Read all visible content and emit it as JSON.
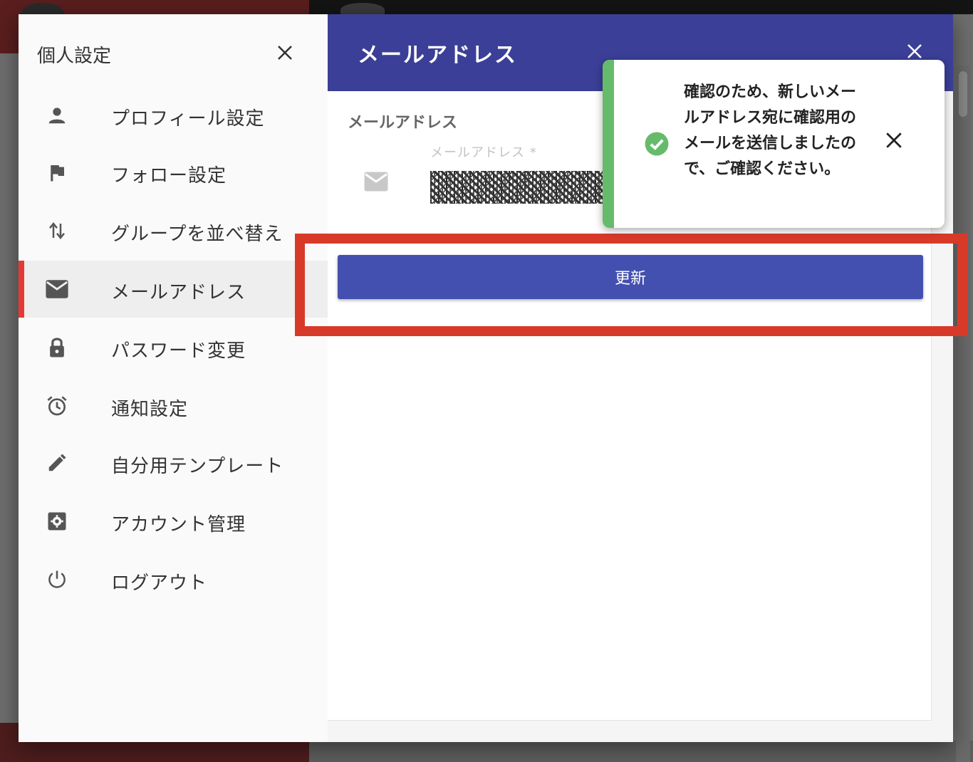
{
  "sidebar": {
    "title": "個人設定",
    "items": [
      {
        "label": "プロフィール設定",
        "icon": "person-icon"
      },
      {
        "label": "フォロー設定",
        "icon": "flag-icon"
      },
      {
        "label": "グループを並べ替え",
        "icon": "sort-arrows-icon"
      },
      {
        "label": "メールアドレス",
        "icon": "mail-icon",
        "active": true
      },
      {
        "label": "パスワード変更",
        "icon": "lock-icon"
      },
      {
        "label": "通知設定",
        "icon": "alarm-icon"
      },
      {
        "label": "自分用テンプレート",
        "icon": "pencil-icon"
      },
      {
        "label": "アカウント管理",
        "icon": "settings-box-icon"
      },
      {
        "label": "ログアウト",
        "icon": "power-icon"
      }
    ]
  },
  "main": {
    "title": "メールアドレス",
    "section_label": "メールアドレス",
    "field": {
      "label": "メールアドレス *"
    },
    "update_label": "更新"
  },
  "toast": {
    "message": "確認のため、新しいメールアドレス宛に確認用のメールを送信しましたので、ご確認ください。",
    "status_color": "#66bb6a"
  },
  "colors": {
    "header": "#3b3f97",
    "button": "#4450b0",
    "accent": "#e53935",
    "highlight": "#d83a2a"
  }
}
